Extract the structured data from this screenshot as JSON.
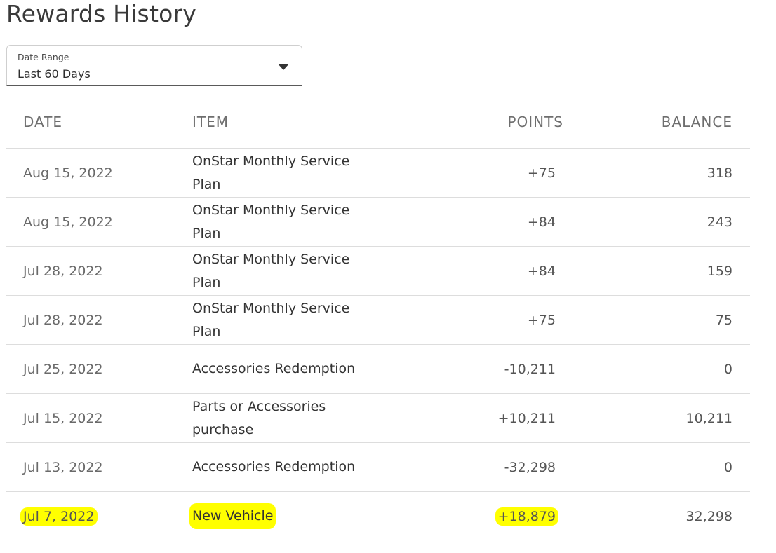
{
  "page": {
    "title": "Rewards History"
  },
  "filter": {
    "label": "Date Range",
    "value": "Last 60 Days"
  },
  "table": {
    "columns": {
      "date": "DATE",
      "item": "ITEM",
      "points": "POINTS",
      "balance": "BALANCE"
    },
    "rows": [
      {
        "date": "Aug 15, 2022",
        "item": "OnStar Monthly Service Plan",
        "points": "+75",
        "balance": "318"
      },
      {
        "date": "Aug 15, 2022",
        "item": "OnStar Monthly Service Plan",
        "points": "+84",
        "balance": "243"
      },
      {
        "date": "Jul 28, 2022",
        "item": "OnStar Monthly Service Plan",
        "points": "+84",
        "balance": "159"
      },
      {
        "date": "Jul 28, 2022",
        "item": "OnStar Monthly Service Plan",
        "points": "+75",
        "balance": "75"
      },
      {
        "date": "Jul 25, 2022",
        "item": "Accessories Redemption",
        "points": "-10,211",
        "balance": "0"
      },
      {
        "date": "Jul 15, 2022",
        "item": "Parts or Accessories purchase",
        "points": "+10,211",
        "balance": "10,211"
      },
      {
        "date": "Jul 13, 2022",
        "item": "Accessories Redemption",
        "points": "-32,298",
        "balance": "0"
      },
      {
        "date": "Jul 7, 2022",
        "item": "New Vehicle",
        "points": "+18,879",
        "balance": "32,298"
      }
    ]
  },
  "colors": {
    "highlight": "#ffff00",
    "divider": "#dddddd"
  }
}
